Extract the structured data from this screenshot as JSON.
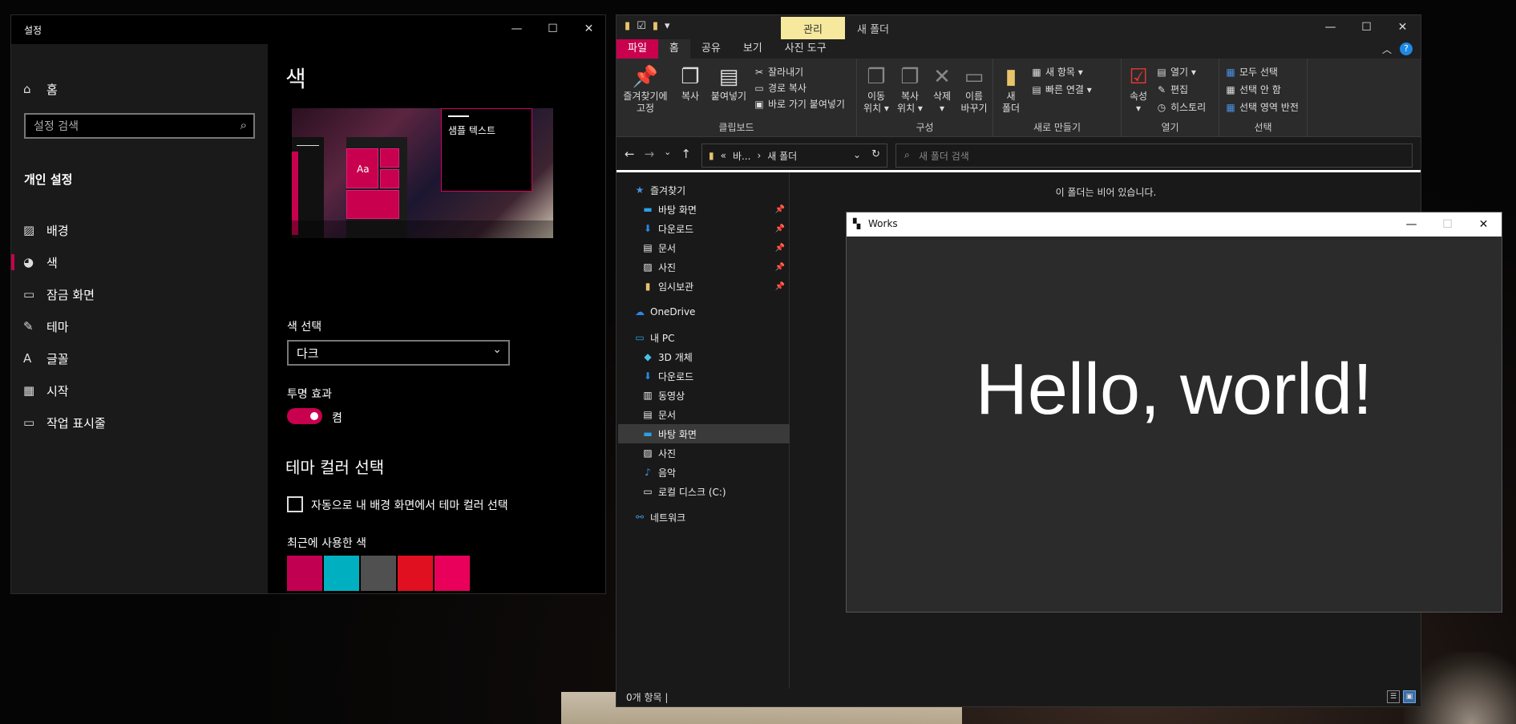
{
  "settings": {
    "window_title": "설정",
    "home_label": "홈",
    "search_placeholder": "설정 검색",
    "section_heading": "개인 설정",
    "nav": [
      {
        "label": "배경",
        "icon": "image-icon"
      },
      {
        "label": "색",
        "icon": "palette-icon"
      },
      {
        "label": "잠금 화면",
        "icon": "lock-screen-icon"
      },
      {
        "label": "테마",
        "icon": "theme-icon"
      },
      {
        "label": "글꼴",
        "icon": "font-icon"
      },
      {
        "label": "시작",
        "icon": "start-icon"
      },
      {
        "label": "작업 표시줄",
        "icon": "taskbar-icon"
      }
    ],
    "page_title": "색",
    "preview_sample_text": "샘플 텍스트",
    "preview_tile_text": "Aa",
    "color_select_label": "색 선택",
    "color_select_value": "다크",
    "transparency_label": "투명 효과",
    "transparency_state": "켬",
    "theme_color_heading": "테마 컬러 선택",
    "auto_color_checkbox_label": "자동으로 내 배경 화면에서 테마 컬러 선택",
    "recent_colors_label": "최근에 사용한 색",
    "recent_colors": [
      "#c20052",
      "#00b0c0",
      "#505050",
      "#e01020",
      "#e8005a"
    ],
    "accent_color": "#c8004e"
  },
  "explorer": {
    "manage_tab": "관리",
    "window_title": "새 폴더",
    "tabs": [
      "파일",
      "홈",
      "공유",
      "보기",
      "사진 도구"
    ],
    "ribbon": {
      "pin_quick_access": [
        "즐겨찾기에",
        "고정"
      ],
      "copy": "복사",
      "paste": "붙여넣기",
      "cut": "잘라내기",
      "copy_path": "경로 복사",
      "paste_shortcut": "바로 가기 붙여넣기",
      "clipboard_group": "클립보드",
      "move_to": [
        "이동",
        "위치 ▾"
      ],
      "copy_to": [
        "복사",
        "위치 ▾"
      ],
      "delete": [
        "삭제",
        "▾"
      ],
      "rename": [
        "이름",
        "바꾸기"
      ],
      "organize_group": "구성",
      "new_folder": [
        "새",
        "폴더"
      ],
      "new_item": "새 항목 ▾",
      "easy_access": "빠른 연결 ▾",
      "new_group": "새로 만들기",
      "properties": [
        "속성",
        "▾"
      ],
      "open": "열기 ▾",
      "edit": "편집",
      "history": "히스토리",
      "open_group": "열기",
      "select_all": "모두 선택",
      "select_none": "선택 안 함",
      "invert_selection": "선택 영역 반전",
      "select_group": "선택"
    },
    "address": {
      "ellipsis": "«",
      "crumb1": "바...",
      "sep": "›",
      "crumb2": "새 폴더"
    },
    "search_placeholder": "새 폴더 검색",
    "tree": {
      "quick_access": "즐겨찾기",
      "quick_items": [
        "바탕 화면",
        "다운로드",
        "문서",
        "사진",
        "임시보관"
      ],
      "onedrive": "OneDrive",
      "this_pc": "내 PC",
      "pc_items": [
        "3D 개체",
        "다운로드",
        "동영상",
        "문서",
        "바탕 화면",
        "사진",
        "음악",
        "로컬 디스크 (C:)"
      ],
      "network": "네트워크"
    },
    "empty_message": "이 폴더는 비어 있습니다.",
    "status": "0개 항목  |"
  },
  "works": {
    "window_title": "Works",
    "hello_text": "Hello, world!"
  }
}
